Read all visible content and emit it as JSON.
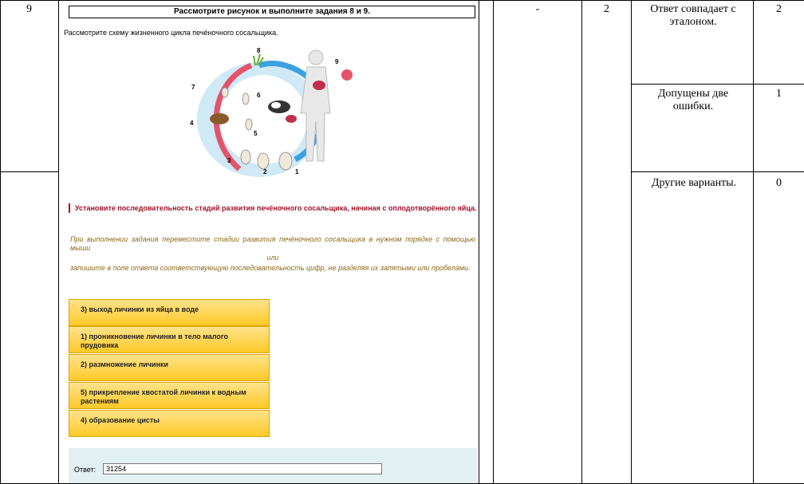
{
  "table": {
    "task_number": "9",
    "col_dash": "-",
    "max_score": "2",
    "criteria": [
      {
        "text": "Ответ совпадает с эталоном.",
        "score": "2"
      },
      {
        "text": "Допущены две ошибки.",
        "score": "1"
      },
      {
        "text": "Другие варианты.",
        "score": "0"
      }
    ]
  },
  "task": {
    "title": "Рассмотрите рисунок и выполните задания 8 и 9.",
    "intro": "Рассмотрите схему жизненного цикла печёночного сосальщика.",
    "figure_labels": [
      "1",
      "2",
      "3",
      "4",
      "5",
      "6",
      "7",
      "8",
      "9"
    ],
    "instruction": "Установите последовательность стадий развития печёночного сосальщика, начиная с оплодотворённого яйца.",
    "hint_1": "При выполнении задания переместите стадии развития печёночного сосальщика в нужном порядке с помощью мыши",
    "hint_or": "или",
    "hint_2": "запишите в поле ответа соответствующую последовательность цифр, не разделяя их запятыми или пробелами.",
    "stages": [
      "3) выход личинки из яйца в воде",
      "1) проникновение личинки в тело малого прудовика",
      "2) размножение личинки",
      "5) прикрепление хвостатой личинки к водным растениям",
      "4) образование цисты"
    ],
    "answer_label": "Ответ:",
    "answer_value": "31254"
  },
  "colors": {
    "instruction": "#a3122a",
    "stage_fill": "#ffc928",
    "answer_panel": "#e2f0f2"
  }
}
